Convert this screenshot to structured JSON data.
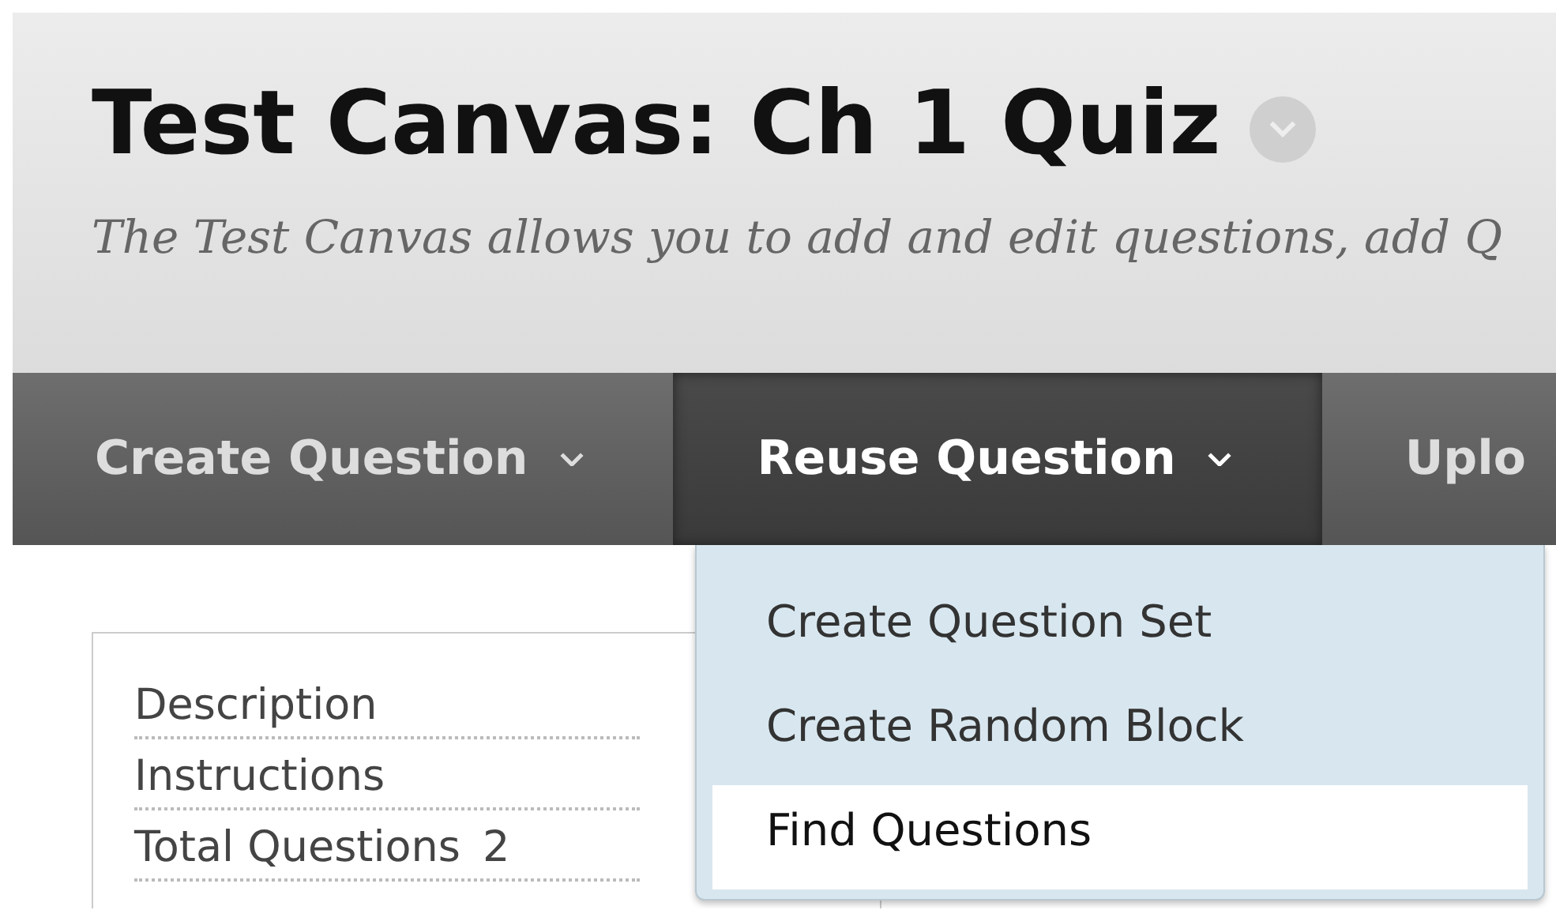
{
  "header": {
    "title": "Test Canvas: Ch 1 Quiz",
    "description": "The Test Canvas allows you to add and edit questions, add Q"
  },
  "nav": [
    {
      "label": "Create Question",
      "selected": false,
      "has_menu": true
    },
    {
      "label": "Reuse Question",
      "selected": true,
      "has_menu": true
    },
    {
      "label": "Uplo",
      "selected": false,
      "has_menu": false
    }
  ],
  "menu": {
    "items": [
      {
        "label": "Create Question Set",
        "selected": false
      },
      {
        "label": "Create Random Block",
        "selected": false
      },
      {
        "label": "Find Questions",
        "selected": true
      }
    ]
  },
  "info": [
    {
      "label": "Description"
    },
    {
      "label": "Instructions"
    },
    {
      "label": "Total Questions",
      "value": "2"
    }
  ]
}
